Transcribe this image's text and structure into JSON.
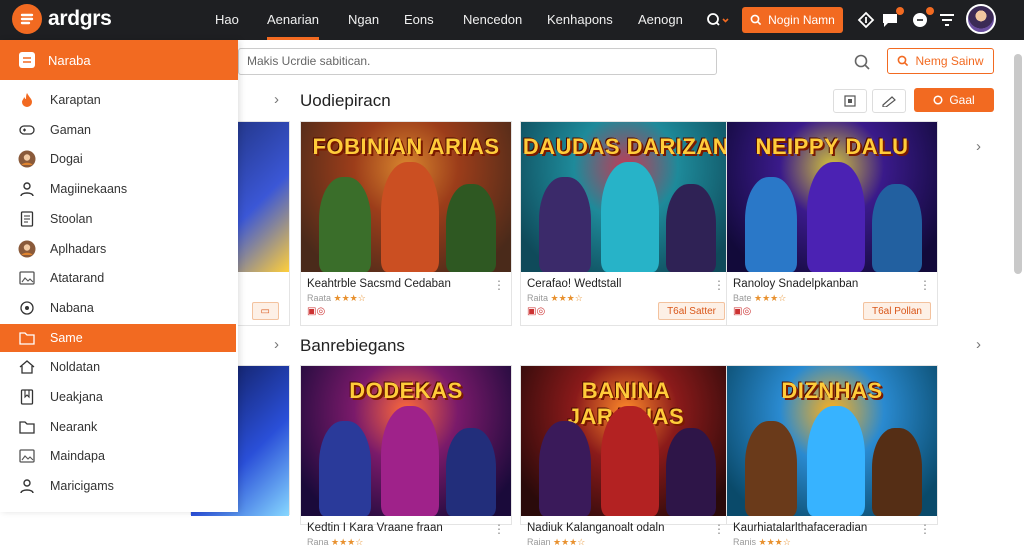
{
  "topbar": {
    "logo": "ardgrs",
    "nav": [
      "Hao",
      "Aenarian",
      "Ngan",
      "Eons",
      "Nencedon",
      "Kenhapons",
      "Aenogn"
    ],
    "active_nav": 1,
    "cta": "Nogin Namn",
    "accent": "#f26a21"
  },
  "sidebar": {
    "header": "Naraba",
    "items": [
      {
        "label": "Karaptan",
        "icon": "flame-icon"
      },
      {
        "label": "Gaman",
        "icon": "controller-icon"
      },
      {
        "label": "Dogai",
        "icon": "avatar-icon"
      },
      {
        "label": "Magiinekaans",
        "icon": "user-icon"
      },
      {
        "label": "Stoolan",
        "icon": "document-icon"
      },
      {
        "label": "Aplhadars",
        "icon": "avatar-icon"
      },
      {
        "label": "Atatarand",
        "icon": "image-icon"
      },
      {
        "label": "Nabana",
        "icon": "target-icon"
      },
      {
        "label": "Same",
        "icon": "folder-icon"
      },
      {
        "label": "Noldatan",
        "icon": "home-icon"
      },
      {
        "label": "Ueakjana",
        "icon": "bookmark-icon"
      },
      {
        "label": "Nearank",
        "icon": "folder-icon"
      },
      {
        "label": "Maindapa",
        "icon": "image-icon"
      },
      {
        "label": "Maricigams",
        "icon": "user-icon"
      }
    ],
    "active_index": 8
  },
  "search": {
    "placeholder": "Makis Ucrdie sabitican."
  },
  "toolbar": {
    "primary_btn": "Nemg Sainw",
    "small_btn": "Gaal"
  },
  "sections": [
    {
      "title": "Uodiepiracn",
      "cards": [
        {
          "name": "Keahtrble Sacsmd Cedaban",
          "meta": "Raata",
          "price": "",
          "art": "FOBINIAN ARIAS"
        },
        {
          "name": "Cerafao! Wedtstall",
          "meta": "Raita",
          "price": "T6al Satter",
          "art": "DAUDAS DARIZAN"
        },
        {
          "name": "Ranoloy Snadelpkanban",
          "meta": "Bate",
          "price": "T6al Pollan",
          "art": "NEIPPY DALU"
        }
      ]
    },
    {
      "title": "Banrebiegans",
      "cards": [
        {
          "name": "Kedtin I Kara Vraane fraan",
          "meta": "Rana",
          "price": "",
          "art": "DODEKAS"
        },
        {
          "name": "Nadiuk Kalanganoalt odaln",
          "meta": "Raian",
          "price": "",
          "art": "BANINA JARABIAS"
        },
        {
          "name": "Kaurhiatalarlthafaceradian",
          "meta": "Ranis",
          "price": "",
          "art": "DIZNHAS"
        }
      ]
    }
  ]
}
